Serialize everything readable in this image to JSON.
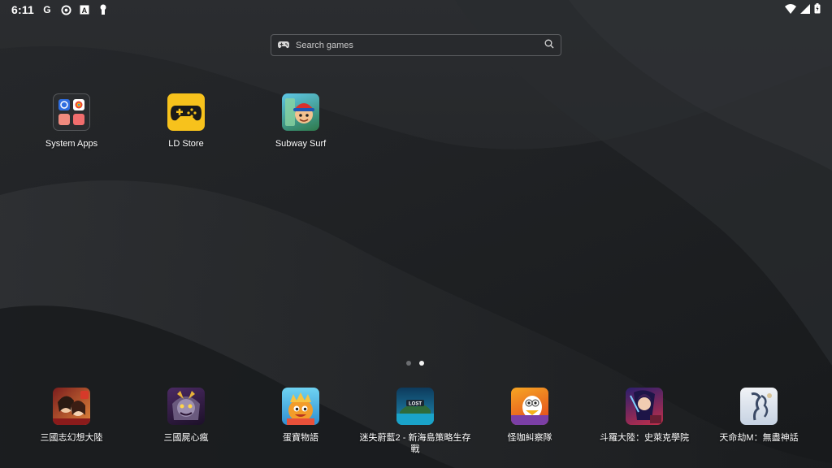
{
  "status_bar": {
    "time": "6:11",
    "notification_icons": [
      "google-g-icon",
      "sync-icon",
      "a-box-icon",
      "keyhole-icon"
    ],
    "system_icons": [
      "wifi-icon",
      "cellular-signal-icon",
      "battery-icon"
    ]
  },
  "search": {
    "placeholder": "Search games",
    "left_icon": "gamepad-icon",
    "right_icon": "search-icon"
  },
  "home_apps": [
    {
      "label": "System Apps",
      "icon": "system-apps-folder-icon"
    },
    {
      "label": "LD Store",
      "icon": "ld-store-gamepad-icon"
    },
    {
      "label": "Subway Surf",
      "icon": "subway-surf-icon"
    }
  ],
  "page_indicator": {
    "pages": 2,
    "current": 2
  },
  "dock_apps": [
    {
      "label": "三國志幻想大陸",
      "icon": "sanguo-fantasy-icon"
    },
    {
      "label": "三國屍心瘋",
      "icon": "sanguo-zombie-icon"
    },
    {
      "label": "蛋寶物語",
      "icon": "egg-treasure-icon"
    },
    {
      "label": "迷失蔚藍2 - 新海島策略生存戰",
      "icon": "lost-blue-icon"
    },
    {
      "label": "怪咖糾察隊",
      "icon": "weird-squad-icon"
    },
    {
      "label": "斗羅大陸：史萊克學院",
      "icon": "douluo-icon"
    },
    {
      "label": "天命劫M：無盡神話",
      "icon": "tianming-icon"
    }
  ],
  "colors": {
    "ld_store_yellow": "#f7c21c",
    "wallpaper_base": "#1e2022",
    "active_dot": "#f2f2f2"
  }
}
